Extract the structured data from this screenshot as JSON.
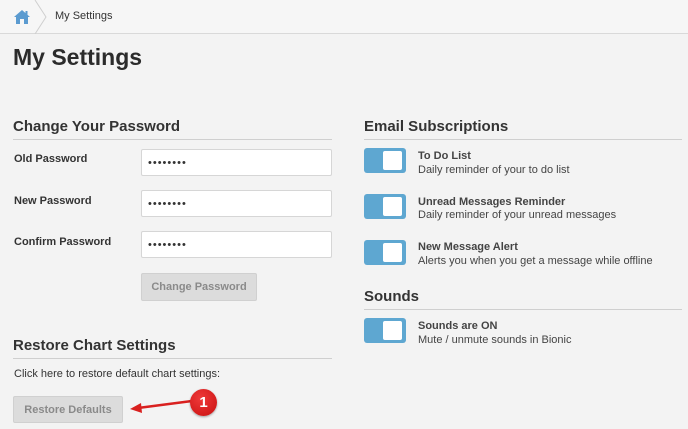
{
  "breadcrumb": {
    "current": "My Settings"
  },
  "page": {
    "title": "My Settings"
  },
  "password": {
    "section_title": "Change Your Password",
    "old_label": "Old Password",
    "new_label": "New Password",
    "confirm_label": "Confirm Password",
    "old_value": "••••••••",
    "new_value": "••••••••",
    "confirm_value": "••••••••",
    "button_label": "Change Password"
  },
  "restore": {
    "section_title": "Restore Chart Settings",
    "description": "Click here to restore default chart settings:",
    "button_label": "Restore Defaults"
  },
  "email": {
    "section_title": "Email Subscriptions",
    "items": [
      {
        "title": "To Do List",
        "description": "Daily reminder of your to do list",
        "enabled": true
      },
      {
        "title": "Unread Messages Reminder",
        "description": "Daily reminder of your unread messages",
        "enabled": true
      },
      {
        "title": "New Message Alert",
        "description": "Alerts you when you get a message while offline",
        "enabled": true
      }
    ]
  },
  "sounds": {
    "section_title": "Sounds",
    "items": [
      {
        "title": "Sounds are ON",
        "description": "Mute / unmute sounds in Bionic",
        "enabled": true
      }
    ]
  },
  "annotation": {
    "badge_number": "1"
  },
  "colors": {
    "toggle_on": "#5ea7d1",
    "home_icon": "#5b9bd0",
    "annotation_red": "#d9201f"
  }
}
